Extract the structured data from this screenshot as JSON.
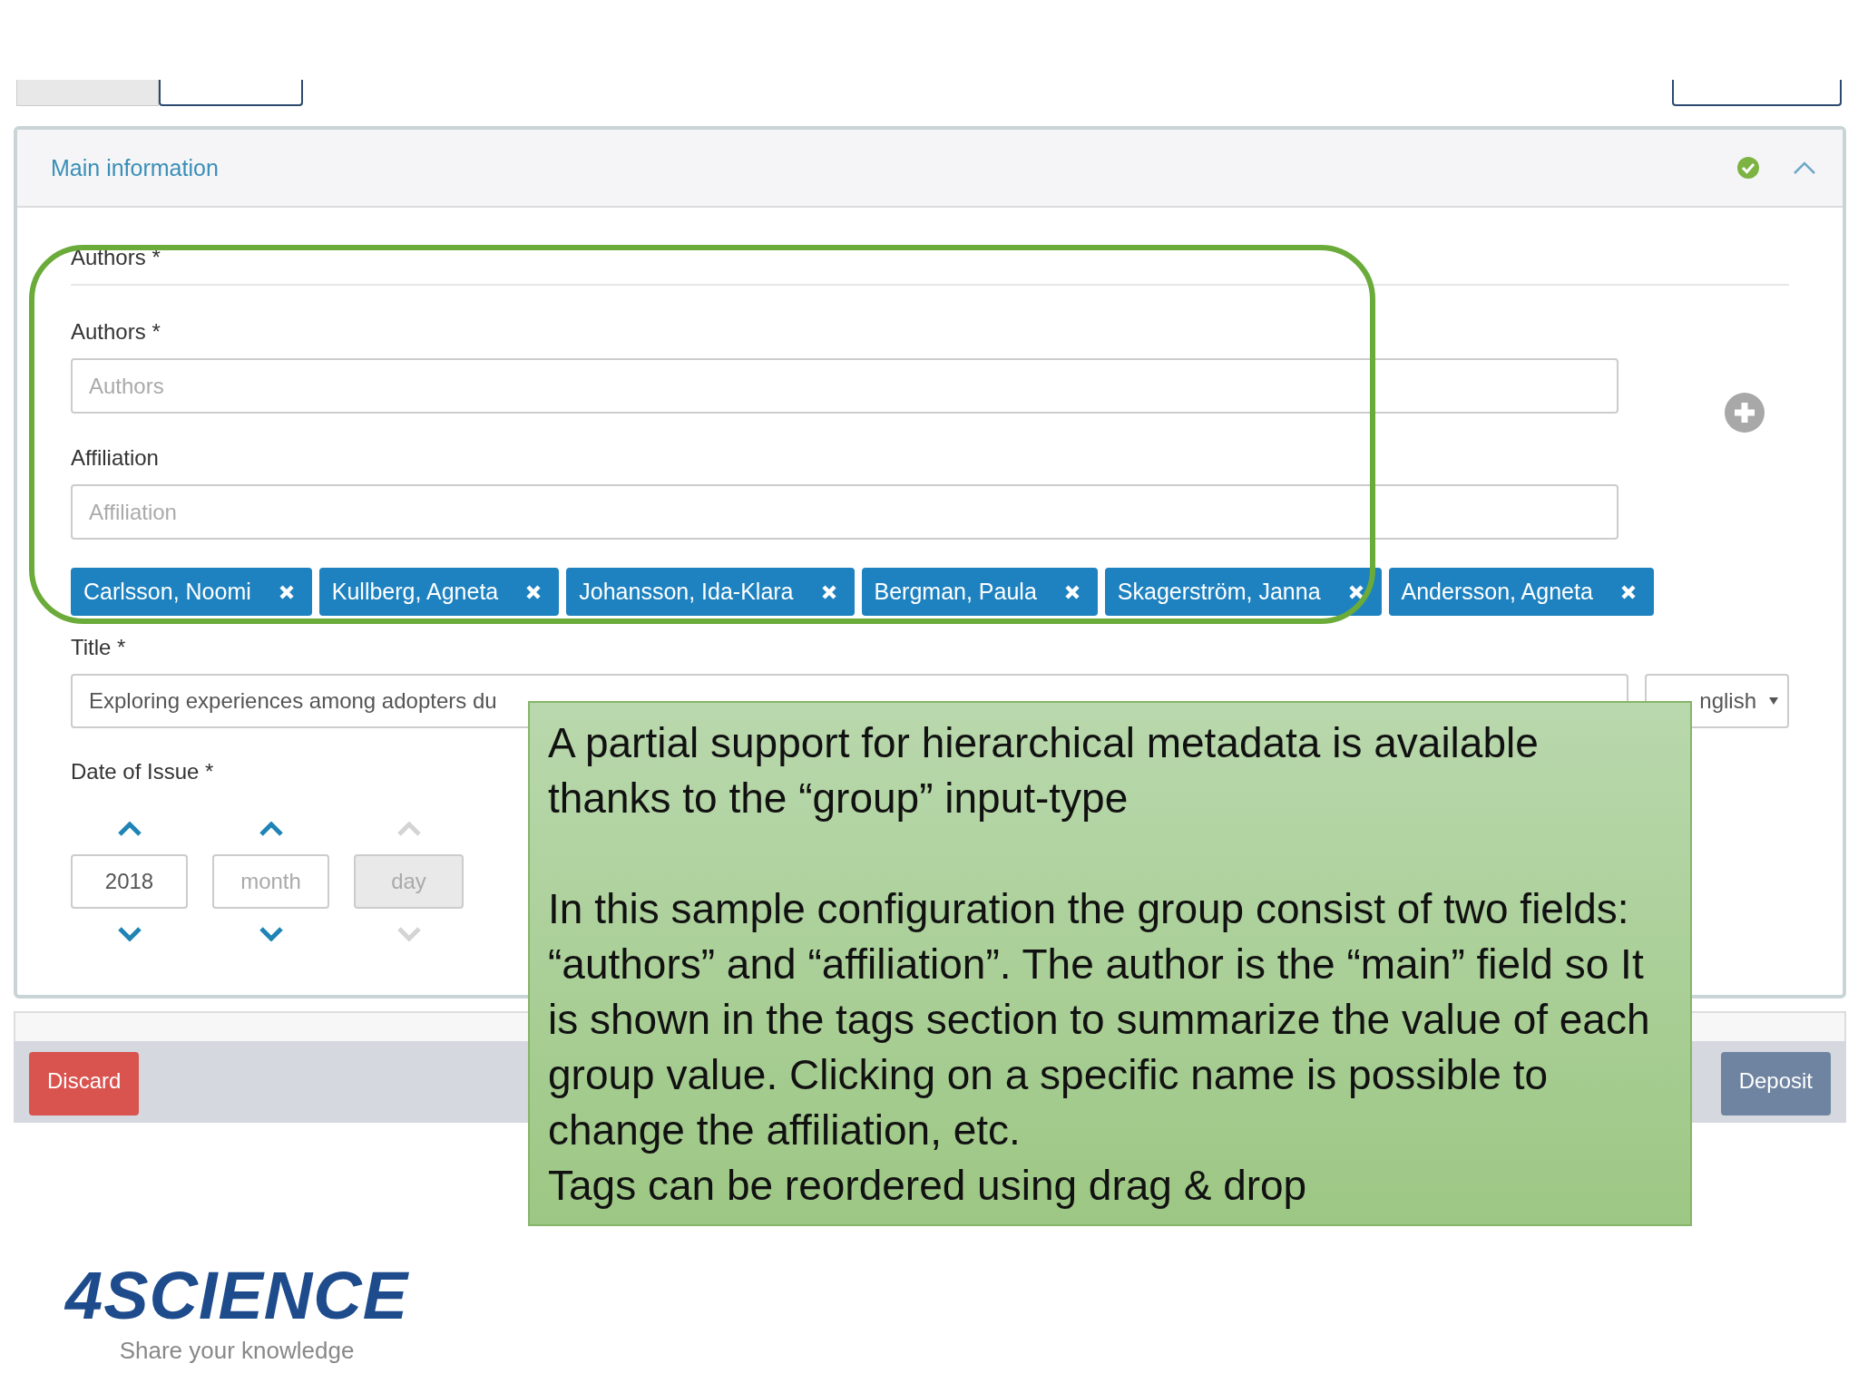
{
  "screenshot": {
    "panel": {
      "title": "Main information",
      "complete": true,
      "expanded": true,
      "group_label": "Authors *",
      "fields": [
        {
          "label": "Authors *",
          "placeholder": "Authors"
        },
        {
          "label": "Affiliation",
          "placeholder": "Affiliation"
        }
      ],
      "tags": [
        {
          "label": "Carlsson, Noomi"
        },
        {
          "label": "Kullberg, Agneta"
        },
        {
          "label": "Johansson, Ida-Klara"
        },
        {
          "label": "Bergman, Paula"
        },
        {
          "label": "Skagerström, Janna"
        },
        {
          "label": "Andersson, Agneta"
        }
      ],
      "title_field": {
        "label": "Title *",
        "value": "Exploring experiences among adopters du",
        "language": "nglish"
      },
      "date": {
        "label": "Date of Issue *",
        "parts": [
          {
            "value": "2018",
            "disabled": false
          },
          {
            "placeholder": "month",
            "disabled": false
          },
          {
            "placeholder": "day",
            "disabled": true
          }
        ]
      }
    },
    "footer": {
      "buttons": [
        {
          "label": "Discard",
          "kind": "danger"
        },
        {
          "label": "Deposit",
          "kind": "primary"
        }
      ]
    }
  },
  "callout": {
    "paragraphs": [
      "A partial support for hierarchical metadata is available thanks to the “group” input-type",
      "In this sample configuration the group consist of two fields: “authors” and “affiliation”. The author is the “main” field so It is shown in the tags section to summarize the value of each group value. Clicking on a specific name is possible to change the affiliation, etc.",
      "Tags can be reordered using drag & drop"
    ]
  },
  "logo": {
    "name": "4SCIENCE",
    "tagline": "Share your knowledge"
  }
}
